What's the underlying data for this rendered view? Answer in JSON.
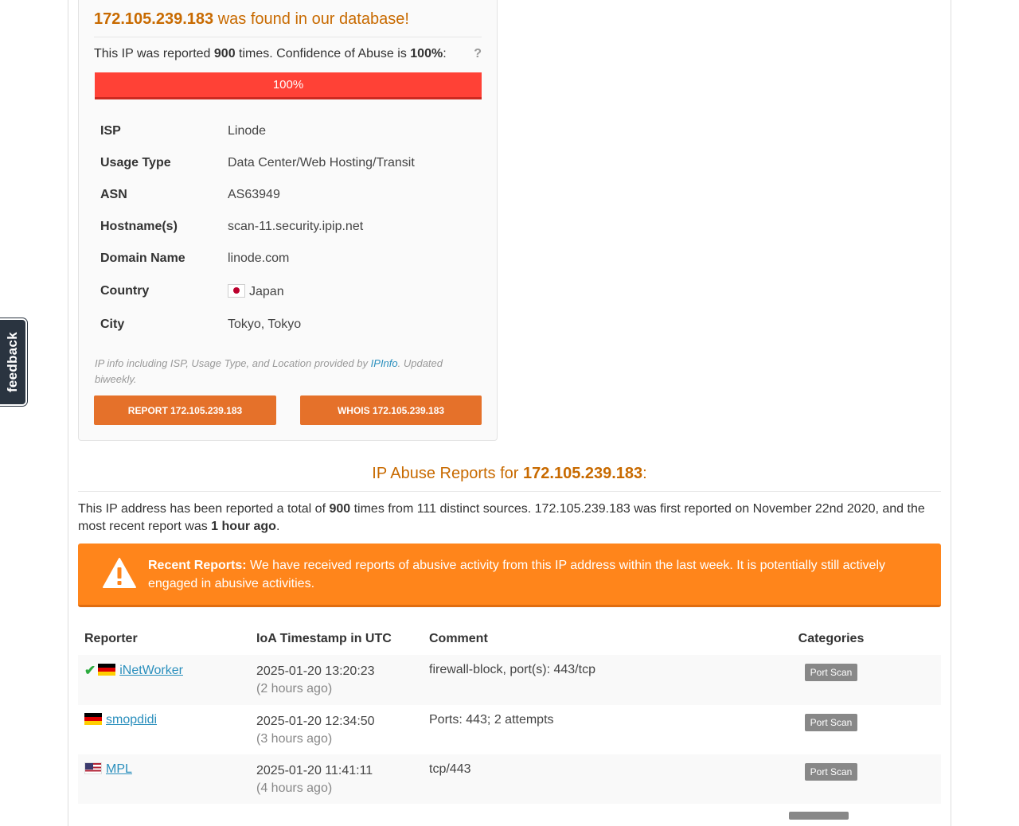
{
  "feedback": {
    "label": "feedback"
  },
  "card": {
    "ip": "172.105.239.183",
    "found_suffix": " was found in our database!",
    "reported_prefix": "This IP was reported ",
    "report_count": "900",
    "reported_mid": " times. Confidence of Abuse is ",
    "confidence": "100%",
    "reported_suffix": ":",
    "help": "?",
    "progress_label": "100%",
    "progress_fraction": 1.0,
    "info": [
      {
        "key": "ISP",
        "value": "Linode"
      },
      {
        "key": "Usage Type",
        "value": "Data Center/Web Hosting/Transit"
      },
      {
        "key": "ASN",
        "value": "AS63949"
      },
      {
        "key": "Hostname(s)",
        "value": "scan-11.security.ipip.net"
      },
      {
        "key": "Domain Name",
        "value": "linode.com"
      },
      {
        "key": "Country",
        "value": "Japan"
      },
      {
        "key": "City",
        "value": "Tokyo, Tokyo"
      }
    ],
    "note_prefix": "IP info including ISP, Usage Type, and Location provided by ",
    "note_link": "IPInfo",
    "note_suffix": ". Updated biweekly.",
    "report_button": "REPORT 172.105.239.183",
    "whois_button": "WHOIS 172.105.239.183"
  },
  "reports": {
    "title_prefix": "IP Abuse Reports for ",
    "title_ip": "172.105.239.183",
    "title_suffix": ":",
    "summary_1": "This IP address has been reported a total of ",
    "summary_count": "900",
    "summary_2": " times from 111 distinct sources. 172.105.239.183 was first reported on November 22nd 2020, and the most recent report was ",
    "summary_recent": "1 hour ago",
    "summary_3": ".",
    "alert_bold": "Recent Reports:",
    "alert_text": " We have received reports of abusive activity from this IP address within the last week. It is potentially still actively engaged in abusive activities.",
    "colors": {
      "alert": "#ff851b",
      "title": "#c86a00",
      "progress": "#ff4136",
      "button": "#e5712a"
    },
    "headers": {
      "reporter": "Reporter",
      "timestamp": "IoA Timestamp in UTC",
      "comment": "Comment",
      "categories": "Categories"
    },
    "rows": [
      {
        "verified": true,
        "flag": "de-flag",
        "reporter": "iNetWorker",
        "timestamp": "2025-01-20 13:20:23",
        "ago": "(2 hours ago)",
        "comment": "firewall-block, port(s): 443/tcp",
        "category": "Port Scan"
      },
      {
        "verified": false,
        "flag": "de-flag",
        "reporter": "smopdidi",
        "timestamp": "2025-01-20 12:34:50",
        "ago": "(3 hours ago)",
        "comment": "Ports: 443; 2 attempts",
        "category": "Port Scan"
      },
      {
        "verified": false,
        "flag": "us-flag",
        "reporter": "MPL",
        "timestamp": "2025-01-20 11:41:11",
        "ago": "(4 hours ago)",
        "comment": "tcp/443",
        "category": "Port Scan"
      }
    ]
  }
}
